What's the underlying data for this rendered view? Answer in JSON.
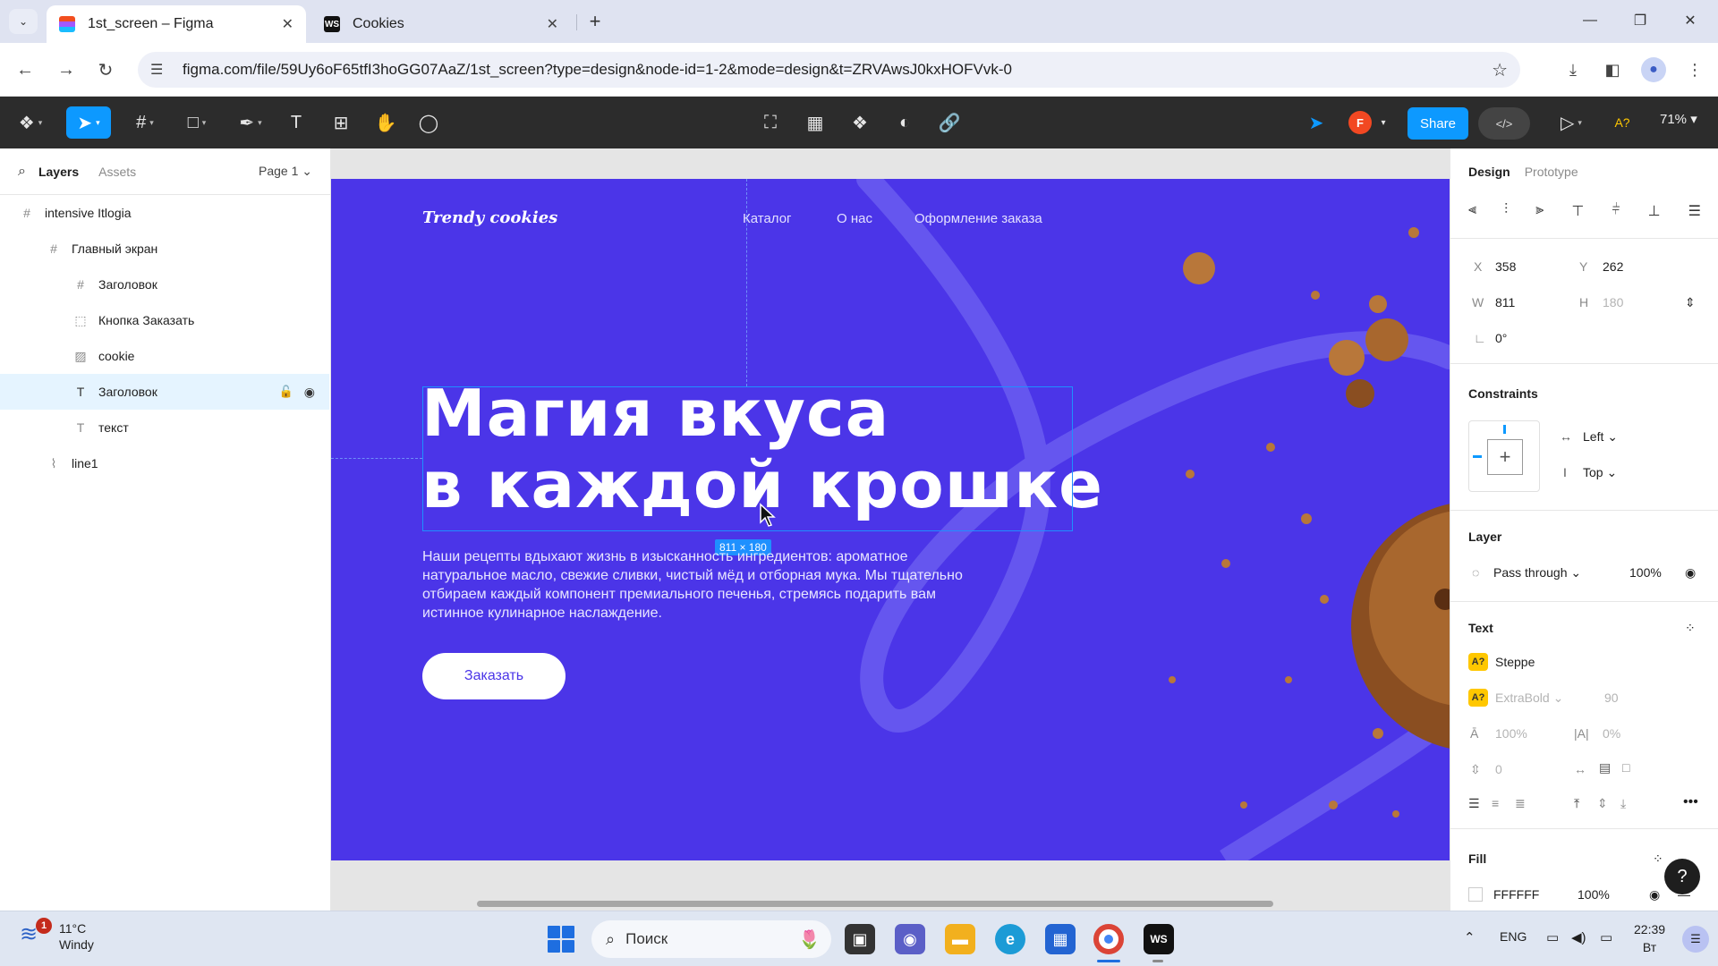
{
  "browser": {
    "tabs": [
      {
        "title": "1st_screen – Figma",
        "active": true
      },
      {
        "title": "Cookies",
        "active": false
      }
    ],
    "url": "figma.com/file/59Uy6oF65tfI3hoGG07AaZ/1st_screen?type=design&node-id=1-2&mode=design&t=ZRVAwsJ0kxHOFVvk-0"
  },
  "toolbar": {
    "share_label": "Share",
    "user_initial": "F",
    "zoom": "71%",
    "font_badge": "A?"
  },
  "left_panel": {
    "tab_layers": "Layers",
    "tab_assets": "Assets",
    "page": "Page 1",
    "layers": [
      {
        "name": "intensive Itlogia",
        "icon": "frame-icon"
      },
      {
        "name": "Главный экран",
        "icon": "frame-icon"
      },
      {
        "name": "Заголовок",
        "icon": "frame-icon"
      },
      {
        "name": "Кнопка Заказать",
        "icon": "dashed-frame-icon"
      },
      {
        "name": "cookie",
        "icon": "image-icon"
      },
      {
        "name": "Заголовок",
        "icon": "text-icon",
        "selected": true
      },
      {
        "name": "текст",
        "icon": "text-icon"
      },
      {
        "name": "line1",
        "icon": "vector-icon"
      }
    ]
  },
  "canvas": {
    "logo": "Trendy cookies",
    "nav": [
      "Каталог",
      "О нас",
      "Оформление заказа"
    ],
    "title_line1": "Магия вкуса",
    "title_line2": "в каждой крошке",
    "selection_size": "811 × 180",
    "body_text": "Наши рецепты вдыхают жизнь в изысканность ингредиентов: ароматное натуральное масло, свежие сливки, чистый мёд и отборная мука. Мы тщательно отбираем каждый компонент премиального печенья, стремясь подарить вам истинное кулинарное наслаждение.",
    "order_button": "Заказать",
    "colors": {
      "frame_bg": "#4b35e8",
      "selection": "#1e90ff"
    }
  },
  "right_panel": {
    "tab_design": "Design",
    "tab_prototype": "Prototype",
    "x_label": "X",
    "x": "358",
    "y_label": "Y",
    "y": "262",
    "w_label": "W",
    "w": "811",
    "h_label": "H",
    "h": "180",
    "rotation": "0°",
    "constraints_title": "Constraints",
    "constraint_h": "Left",
    "constraint_v": "Top",
    "layer_title": "Layer",
    "blend": "Pass through",
    "opacity": "100%",
    "text_title": "Text",
    "font_family": "Steppe",
    "font_weight": "ExtraBold",
    "font_size": "90",
    "line_height": "100%",
    "letter_spacing": "0%",
    "paragraph_spacing": "0",
    "fill_title": "Fill",
    "fill_hex": "FFFFFF",
    "fill_opacity": "100%"
  },
  "taskbar": {
    "notification_count": "1",
    "temperature": "11°C",
    "weather": "Windy",
    "search_placeholder": "Поиск",
    "lang": "ENG",
    "time": "22:39",
    "day": "Вт"
  }
}
